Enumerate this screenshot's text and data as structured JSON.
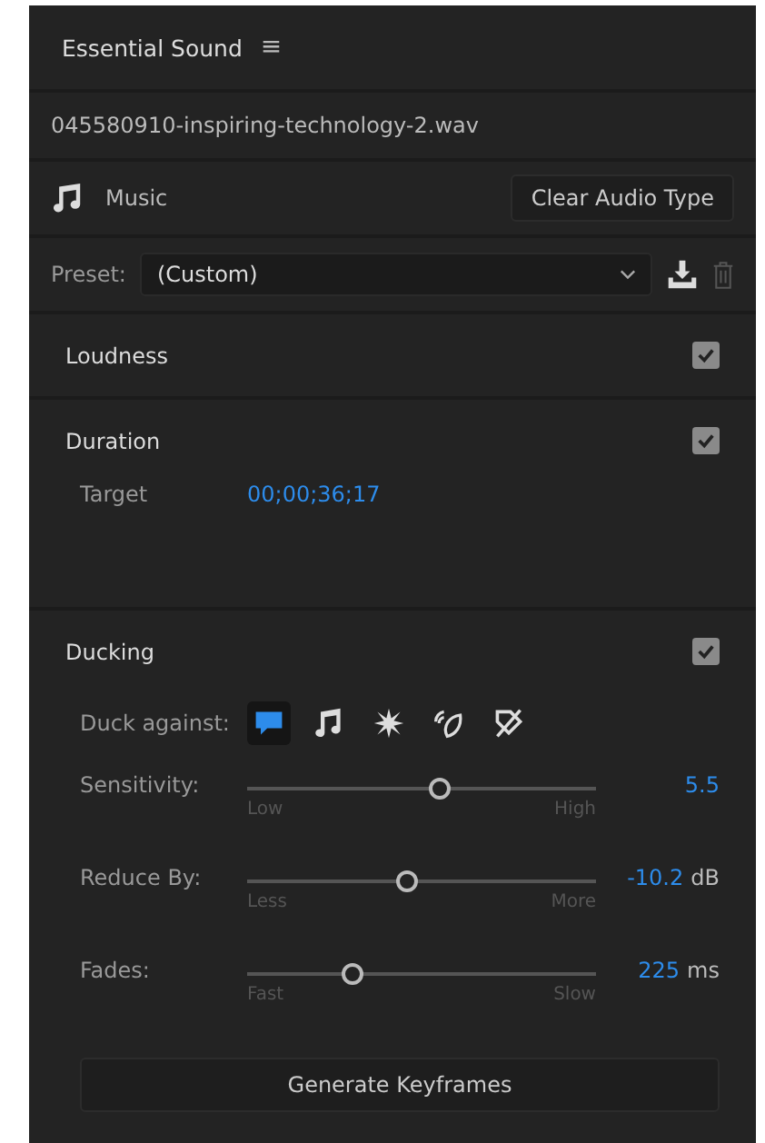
{
  "panel": {
    "title": "Essential Sound",
    "menu_glyph": "≡"
  },
  "clip": {
    "filename": "045580910-inspiring-technology-2.wav"
  },
  "audio_type": {
    "label": "Music",
    "clear_button": "Clear Audio Type"
  },
  "preset": {
    "label": "Preset:",
    "value": "(Custom)"
  },
  "sections": [
    {
      "title": "Loudness",
      "checked": true
    },
    {
      "title": "Duration",
      "checked": true,
      "target_label": "Target",
      "target_value": "00;00;36;17"
    },
    {
      "title": "Ducking",
      "checked": true
    }
  ],
  "ducking": {
    "duck_against_label": "Duck against:",
    "sources": [
      {
        "kind": "dialogue",
        "selected": true
      },
      {
        "kind": "music",
        "selected": false
      },
      {
        "kind": "sfx",
        "selected": false
      },
      {
        "kind": "ambience",
        "selected": false
      },
      {
        "kind": "unassigned",
        "selected": false
      }
    ],
    "sliders": [
      {
        "label": "Sensitivity:",
        "level": 0.55,
        "min_label": "Low",
        "max_label": "High",
        "value": "5.5"
      },
      {
        "label": "Reduce By:",
        "level": 0.46,
        "min_label": "Less",
        "max_label": "More",
        "value": "-10.2",
        "unit": "dB"
      },
      {
        "label": "Fades:",
        "level": 0.3,
        "min_label": "Fast",
        "max_label": "Slow",
        "value": "225",
        "unit": "ms"
      }
    ],
    "generate_button": "Generate Keyframes"
  }
}
